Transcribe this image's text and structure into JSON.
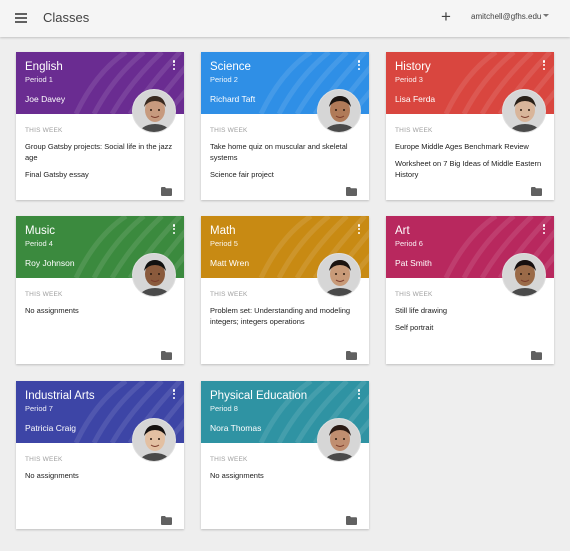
{
  "appbar": {
    "title": "Classes",
    "add_label": "+",
    "account": "amitchell@gfhs.edu",
    "menu_icon": "menu-icon",
    "caret_icon": "caret-down-icon"
  },
  "week_label": "THIS WEEK",
  "classes": [
    {
      "name": "English",
      "period": "Period 1",
      "teacher": "Joe Davey",
      "color": "#6a2c91",
      "assignments": [
        "Group Gatsby projects: Social life in the jazz age",
        "Final Gatsby essay"
      ]
    },
    {
      "name": "Science",
      "period": "Period 2",
      "teacher": "Richard Taft",
      "color": "#2f8fe6",
      "assignments": [
        "Take home quiz on muscular and skeletal systems",
        "Science fair project"
      ]
    },
    {
      "name": "History",
      "period": "Period 3",
      "teacher": "Lisa Ferda",
      "color": "#d9463f",
      "assignments": [
        "Europe Middle Ages Benchmark Review",
        "Worksheet on 7 Big Ideas of Middle Eastern History"
      ]
    },
    {
      "name": "Music",
      "period": "Period 4",
      "teacher": "Roy Johnson",
      "color": "#3b8a3e",
      "assignments": [
        "No assignments"
      ]
    },
    {
      "name": "Math",
      "period": "Period 5",
      "teacher": "Matt Wren",
      "color": "#c88a13",
      "assignments": [
        "Problem set: Understanding and modeling integers; integers operations"
      ]
    },
    {
      "name": "Art",
      "period": "Period 6",
      "teacher": "Pat Smith",
      "color": "#b8285e",
      "assignments": [
        "Still life drawing",
        "Self portrait"
      ]
    },
    {
      "name": "Industrial Arts",
      "period": "Period 7",
      "teacher": "Patricia Craig",
      "color": "#3d45a6",
      "assignments": [
        "No assignments"
      ]
    },
    {
      "name": "Physical Education",
      "period": "Period 8",
      "teacher": "Nora Thomas",
      "color": "#2f93a3",
      "assignments": [
        "No assignments"
      ]
    }
  ]
}
